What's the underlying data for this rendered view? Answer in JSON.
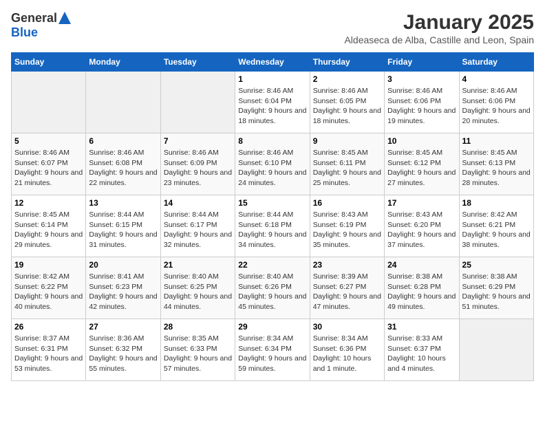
{
  "logo": {
    "general": "General",
    "blue": "Blue"
  },
  "title": "January 2025",
  "subtitle": "Aldeaseca de Alba, Castille and Leon, Spain",
  "days_of_week": [
    "Sunday",
    "Monday",
    "Tuesday",
    "Wednesday",
    "Thursday",
    "Friday",
    "Saturday"
  ],
  "weeks": [
    [
      {
        "day": "",
        "empty": true
      },
      {
        "day": "",
        "empty": true
      },
      {
        "day": "",
        "empty": true
      },
      {
        "day": "1",
        "sunrise": "Sunrise: 8:46 AM",
        "sunset": "Sunset: 6:04 PM",
        "daylight": "Daylight: 9 hours and 18 minutes."
      },
      {
        "day": "2",
        "sunrise": "Sunrise: 8:46 AM",
        "sunset": "Sunset: 6:05 PM",
        "daylight": "Daylight: 9 hours and 18 minutes."
      },
      {
        "day": "3",
        "sunrise": "Sunrise: 8:46 AM",
        "sunset": "Sunset: 6:06 PM",
        "daylight": "Daylight: 9 hours and 19 minutes."
      },
      {
        "day": "4",
        "sunrise": "Sunrise: 8:46 AM",
        "sunset": "Sunset: 6:06 PM",
        "daylight": "Daylight: 9 hours and 20 minutes."
      }
    ],
    [
      {
        "day": "5",
        "sunrise": "Sunrise: 8:46 AM",
        "sunset": "Sunset: 6:07 PM",
        "daylight": "Daylight: 9 hours and 21 minutes."
      },
      {
        "day": "6",
        "sunrise": "Sunrise: 8:46 AM",
        "sunset": "Sunset: 6:08 PM",
        "daylight": "Daylight: 9 hours and 22 minutes."
      },
      {
        "day": "7",
        "sunrise": "Sunrise: 8:46 AM",
        "sunset": "Sunset: 6:09 PM",
        "daylight": "Daylight: 9 hours and 23 minutes."
      },
      {
        "day": "8",
        "sunrise": "Sunrise: 8:46 AM",
        "sunset": "Sunset: 6:10 PM",
        "daylight": "Daylight: 9 hours and 24 minutes."
      },
      {
        "day": "9",
        "sunrise": "Sunrise: 8:45 AM",
        "sunset": "Sunset: 6:11 PM",
        "daylight": "Daylight: 9 hours and 25 minutes."
      },
      {
        "day": "10",
        "sunrise": "Sunrise: 8:45 AM",
        "sunset": "Sunset: 6:12 PM",
        "daylight": "Daylight: 9 hours and 27 minutes."
      },
      {
        "day": "11",
        "sunrise": "Sunrise: 8:45 AM",
        "sunset": "Sunset: 6:13 PM",
        "daylight": "Daylight: 9 hours and 28 minutes."
      }
    ],
    [
      {
        "day": "12",
        "sunrise": "Sunrise: 8:45 AM",
        "sunset": "Sunset: 6:14 PM",
        "daylight": "Daylight: 9 hours and 29 minutes."
      },
      {
        "day": "13",
        "sunrise": "Sunrise: 8:44 AM",
        "sunset": "Sunset: 6:15 PM",
        "daylight": "Daylight: 9 hours and 31 minutes."
      },
      {
        "day": "14",
        "sunrise": "Sunrise: 8:44 AM",
        "sunset": "Sunset: 6:17 PM",
        "daylight": "Daylight: 9 hours and 32 minutes."
      },
      {
        "day": "15",
        "sunrise": "Sunrise: 8:44 AM",
        "sunset": "Sunset: 6:18 PM",
        "daylight": "Daylight: 9 hours and 34 minutes."
      },
      {
        "day": "16",
        "sunrise": "Sunrise: 8:43 AM",
        "sunset": "Sunset: 6:19 PM",
        "daylight": "Daylight: 9 hours and 35 minutes."
      },
      {
        "day": "17",
        "sunrise": "Sunrise: 8:43 AM",
        "sunset": "Sunset: 6:20 PM",
        "daylight": "Daylight: 9 hours and 37 minutes."
      },
      {
        "day": "18",
        "sunrise": "Sunrise: 8:42 AM",
        "sunset": "Sunset: 6:21 PM",
        "daylight": "Daylight: 9 hours and 38 minutes."
      }
    ],
    [
      {
        "day": "19",
        "sunrise": "Sunrise: 8:42 AM",
        "sunset": "Sunset: 6:22 PM",
        "daylight": "Daylight: 9 hours and 40 minutes."
      },
      {
        "day": "20",
        "sunrise": "Sunrise: 8:41 AM",
        "sunset": "Sunset: 6:23 PM",
        "daylight": "Daylight: 9 hours and 42 minutes."
      },
      {
        "day": "21",
        "sunrise": "Sunrise: 8:40 AM",
        "sunset": "Sunset: 6:25 PM",
        "daylight": "Daylight: 9 hours and 44 minutes."
      },
      {
        "day": "22",
        "sunrise": "Sunrise: 8:40 AM",
        "sunset": "Sunset: 6:26 PM",
        "daylight": "Daylight: 9 hours and 45 minutes."
      },
      {
        "day": "23",
        "sunrise": "Sunrise: 8:39 AM",
        "sunset": "Sunset: 6:27 PM",
        "daylight": "Daylight: 9 hours and 47 minutes."
      },
      {
        "day": "24",
        "sunrise": "Sunrise: 8:38 AM",
        "sunset": "Sunset: 6:28 PM",
        "daylight": "Daylight: 9 hours and 49 minutes."
      },
      {
        "day": "25",
        "sunrise": "Sunrise: 8:38 AM",
        "sunset": "Sunset: 6:29 PM",
        "daylight": "Daylight: 9 hours and 51 minutes."
      }
    ],
    [
      {
        "day": "26",
        "sunrise": "Sunrise: 8:37 AM",
        "sunset": "Sunset: 6:31 PM",
        "daylight": "Daylight: 9 hours and 53 minutes."
      },
      {
        "day": "27",
        "sunrise": "Sunrise: 8:36 AM",
        "sunset": "Sunset: 6:32 PM",
        "daylight": "Daylight: 9 hours and 55 minutes."
      },
      {
        "day": "28",
        "sunrise": "Sunrise: 8:35 AM",
        "sunset": "Sunset: 6:33 PM",
        "daylight": "Daylight: 9 hours and 57 minutes."
      },
      {
        "day": "29",
        "sunrise": "Sunrise: 8:34 AM",
        "sunset": "Sunset: 6:34 PM",
        "daylight": "Daylight: 9 hours and 59 minutes."
      },
      {
        "day": "30",
        "sunrise": "Sunrise: 8:34 AM",
        "sunset": "Sunset: 6:36 PM",
        "daylight": "Daylight: 10 hours and 1 minute."
      },
      {
        "day": "31",
        "sunrise": "Sunrise: 8:33 AM",
        "sunset": "Sunset: 6:37 PM",
        "daylight": "Daylight: 10 hours and 4 minutes."
      },
      {
        "day": "",
        "empty": true
      }
    ]
  ]
}
